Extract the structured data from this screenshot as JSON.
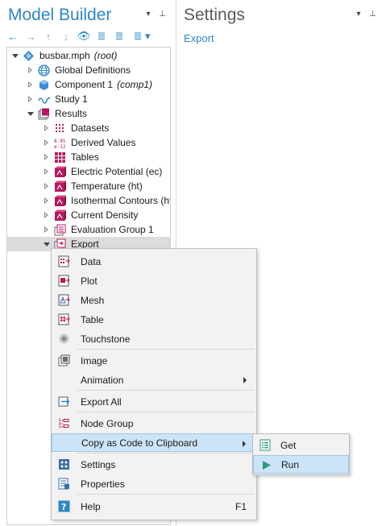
{
  "model_builder": {
    "title": "Model Builder",
    "header_icons": "▾ ⊥",
    "toolbar": [
      "←",
      "→",
      "↑",
      "↓",
      "👁",
      "≣",
      "≣",
      "≣ ▾"
    ],
    "tree": [
      {
        "label": "busbar.mph",
        "tag": "(root)"
      },
      {
        "label": "Global Definitions"
      },
      {
        "label": "Component 1",
        "tag": "(comp1)"
      },
      {
        "label": "Study 1"
      },
      {
        "label": "Results"
      },
      {
        "label": "Datasets"
      },
      {
        "label": "Derived Values"
      },
      {
        "label": "Tables"
      },
      {
        "label": "Electric Potential (ec)"
      },
      {
        "label": "Temperature (ht)"
      },
      {
        "label": "Isothermal Contours (ht)"
      },
      {
        "label": "Current Density"
      },
      {
        "label": "Evaluation Group 1"
      },
      {
        "label": "Export"
      }
    ]
  },
  "settings": {
    "title": "Settings",
    "subtitle": "Export",
    "header_icons": "▾ ⊥"
  },
  "context_menu": {
    "items": [
      {
        "label": "Data"
      },
      {
        "label": "Plot"
      },
      {
        "label": "Mesh"
      },
      {
        "label": "Table"
      },
      {
        "label": "Touchstone"
      },
      {
        "label": "Image"
      },
      {
        "label": "Animation"
      },
      {
        "label": "Export All"
      },
      {
        "label": "Node Group"
      },
      {
        "label": "Copy as Code to Clipboard"
      },
      {
        "label": "Settings"
      },
      {
        "label": "Properties"
      },
      {
        "label": "Help",
        "shortcut": "F1"
      }
    ]
  },
  "submenu": {
    "items": [
      {
        "label": "Get"
      },
      {
        "label": "Run"
      }
    ]
  },
  "colors": {
    "accent": "#2e86c8",
    "results_icon": "#b5185f",
    "highlight": "#cce4f7"
  }
}
